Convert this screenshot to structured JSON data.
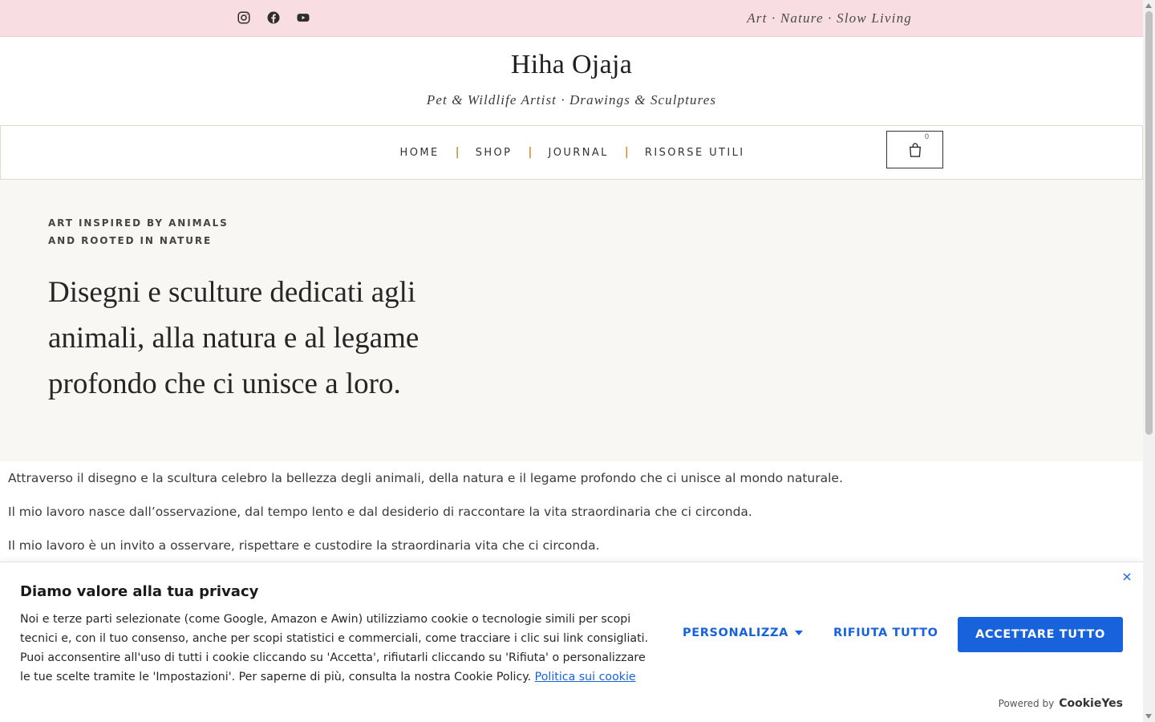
{
  "topbar": {
    "social_icons": [
      "instagram-icon",
      "facebook-icon",
      "youtube-icon"
    ],
    "tagline": "Art · Nature · Slow Living"
  },
  "header": {
    "brand": "Hiha Ojaja",
    "subtitle": "Pet & Wildlife Artist · Drawings & Sculptures"
  },
  "nav": {
    "items": [
      {
        "label": "HOME"
      },
      {
        "label": "SHOP"
      },
      {
        "label": "JOURNAL"
      },
      {
        "label": "RISORSE UTILI"
      }
    ],
    "separator": "|",
    "cart_icon": "shopping-bag-icon",
    "cart_count": "0"
  },
  "hero": {
    "kicker_line1": "ART INSPIRED BY ANIMALS",
    "kicker_line2": "AND ROOTED IN NATURE",
    "title": "Disegni e sculture dedicati agli animali, alla natura e al legame profondo che ci unisce a loro."
  },
  "intro": {
    "paragraphs": [
      "Attraverso il disegno e la scultura celebro la bellezza degli animali, della natura e il legame profondo che ci unisce al mondo naturale.",
      "Il mio lavoro nasce dall’osservazione, dal tempo lento e dal desiderio di raccontare la vita straordinaria che ci circonda.",
      "Il mio lavoro è un invito a osservare, rispettare e custodire la straordinaria vita che ci circonda."
    ]
  },
  "cookie": {
    "title": "Diamo valore alla tua privacy",
    "text": "Noi e terze parti selezionate (come Google, Amazon e Awin) utilizziamo cookie o tecnologie simili per scopi tecnici e, con il tuo consenso, anche per scopi statistici e commerciali, come tracciare i clic sui link consigliati. Puoi acconsentire all'uso di tutti i cookie cliccando su 'Accetta', rifiutarli cliccando su 'Rifiuta' o personalizzare le tue scelte tramite le 'Impostazioni'. Per saperne di più, consulta la nostra Cookie Policy.",
    "policy_link": "Politica sui cookie",
    "customize_label": "PERSONALIZZA",
    "reject_label": "RIFIUTA TUTTO",
    "accept_label": "ACCETTARE TUTTO",
    "powered_by": "Powered by",
    "powered_brand": "CookieYes",
    "accent_color": "#1863dc"
  },
  "colors": {
    "topbar_bg": "#f8dde2",
    "hero_bg": "#f8f7f4",
    "nav_separator": "#c9922f"
  }
}
